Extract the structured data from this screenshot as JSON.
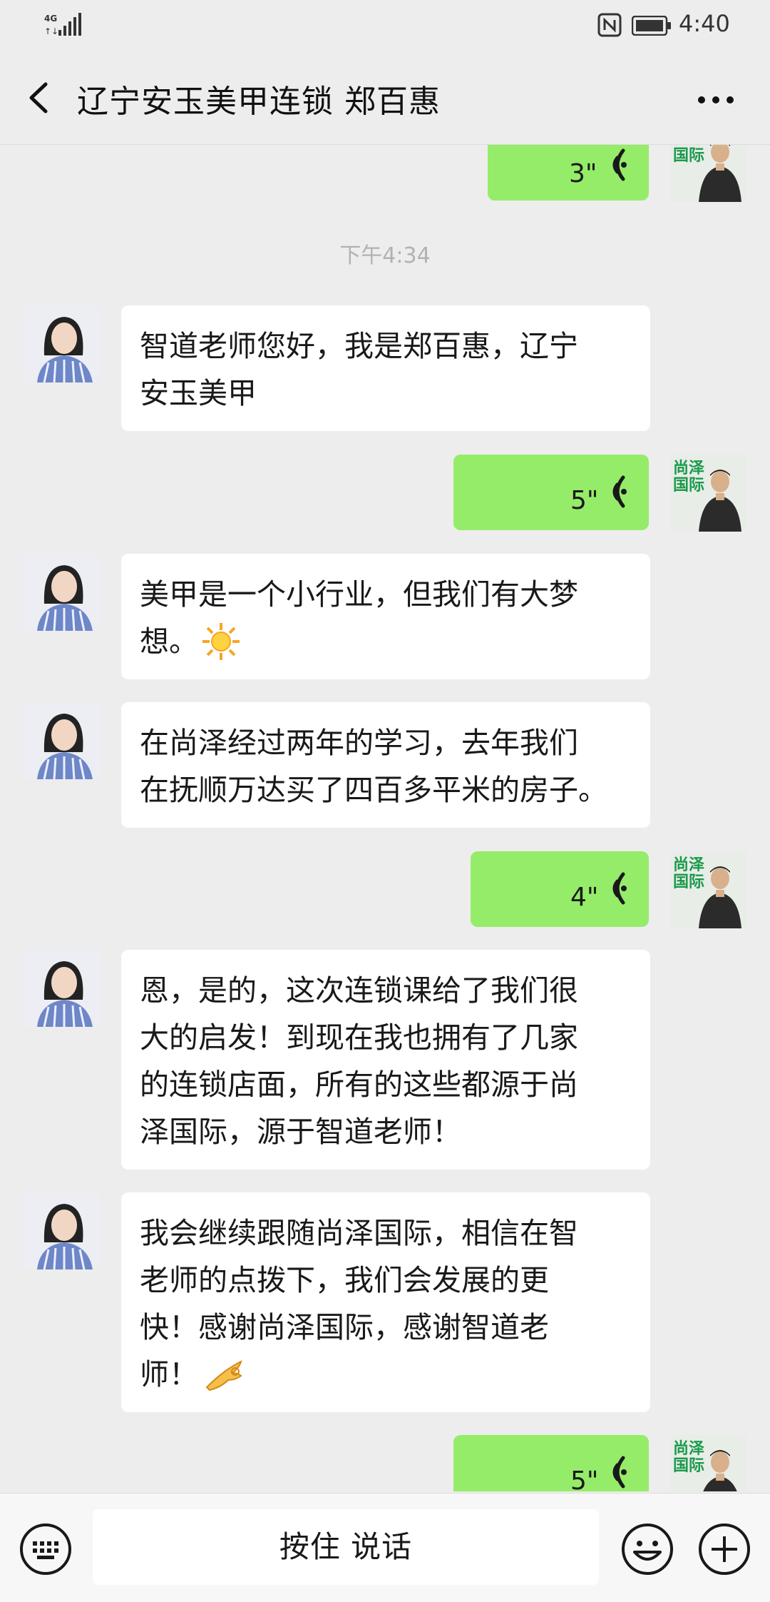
{
  "status_bar": {
    "network": "4G",
    "time": "4:40"
  },
  "header": {
    "title": "辽宁安玉美甲连锁 郑百惠"
  },
  "timestamp": "下午4:34",
  "messages": [
    {
      "dir": "out",
      "type": "voice",
      "duration": "3\""
    },
    {
      "dir": "in",
      "type": "text",
      "lines": [
        "智道老师您好，我是郑百惠，辽宁",
        "安玉美甲"
      ]
    },
    {
      "dir": "out",
      "type": "voice",
      "duration": "5\""
    },
    {
      "dir": "in",
      "type": "text",
      "lines": [
        "美甲是一个小行业，但我们有大梦",
        "想。"
      ],
      "emoji": "sun"
    },
    {
      "dir": "in",
      "type": "text",
      "lines": [
        "在尚泽经过两年的学习，去年我们",
        "在抚顺万达买了四百多平米的房子。"
      ]
    },
    {
      "dir": "out",
      "type": "voice",
      "duration": "4\""
    },
    {
      "dir": "in",
      "type": "text",
      "lines": [
        "恩，是的，这次连锁课给了我们很",
        "大的启发！到现在我也拥有了几家",
        "的连锁店面，所有的这些都源于尚",
        "泽国际，源于智道老师！"
      ]
    },
    {
      "dir": "in",
      "type": "text",
      "lines": [
        "我会继续跟随尚泽国际，相信在智",
        "老师的点拨下，我们会发展的更",
        "快！感谢尚泽国际，感谢智道老",
        "师！"
      ],
      "emoji": "ok-hand"
    },
    {
      "dir": "out",
      "type": "voice",
      "duration": "5\""
    }
  ],
  "avatar_logo_text": [
    "尚泽",
    "国际"
  ],
  "input_bar": {
    "hold_to_talk": "按住 说话"
  },
  "colors": {
    "outgoing_bubble": "#95ec69",
    "background": "#ededed",
    "logo_green": "#1a9a4a"
  }
}
